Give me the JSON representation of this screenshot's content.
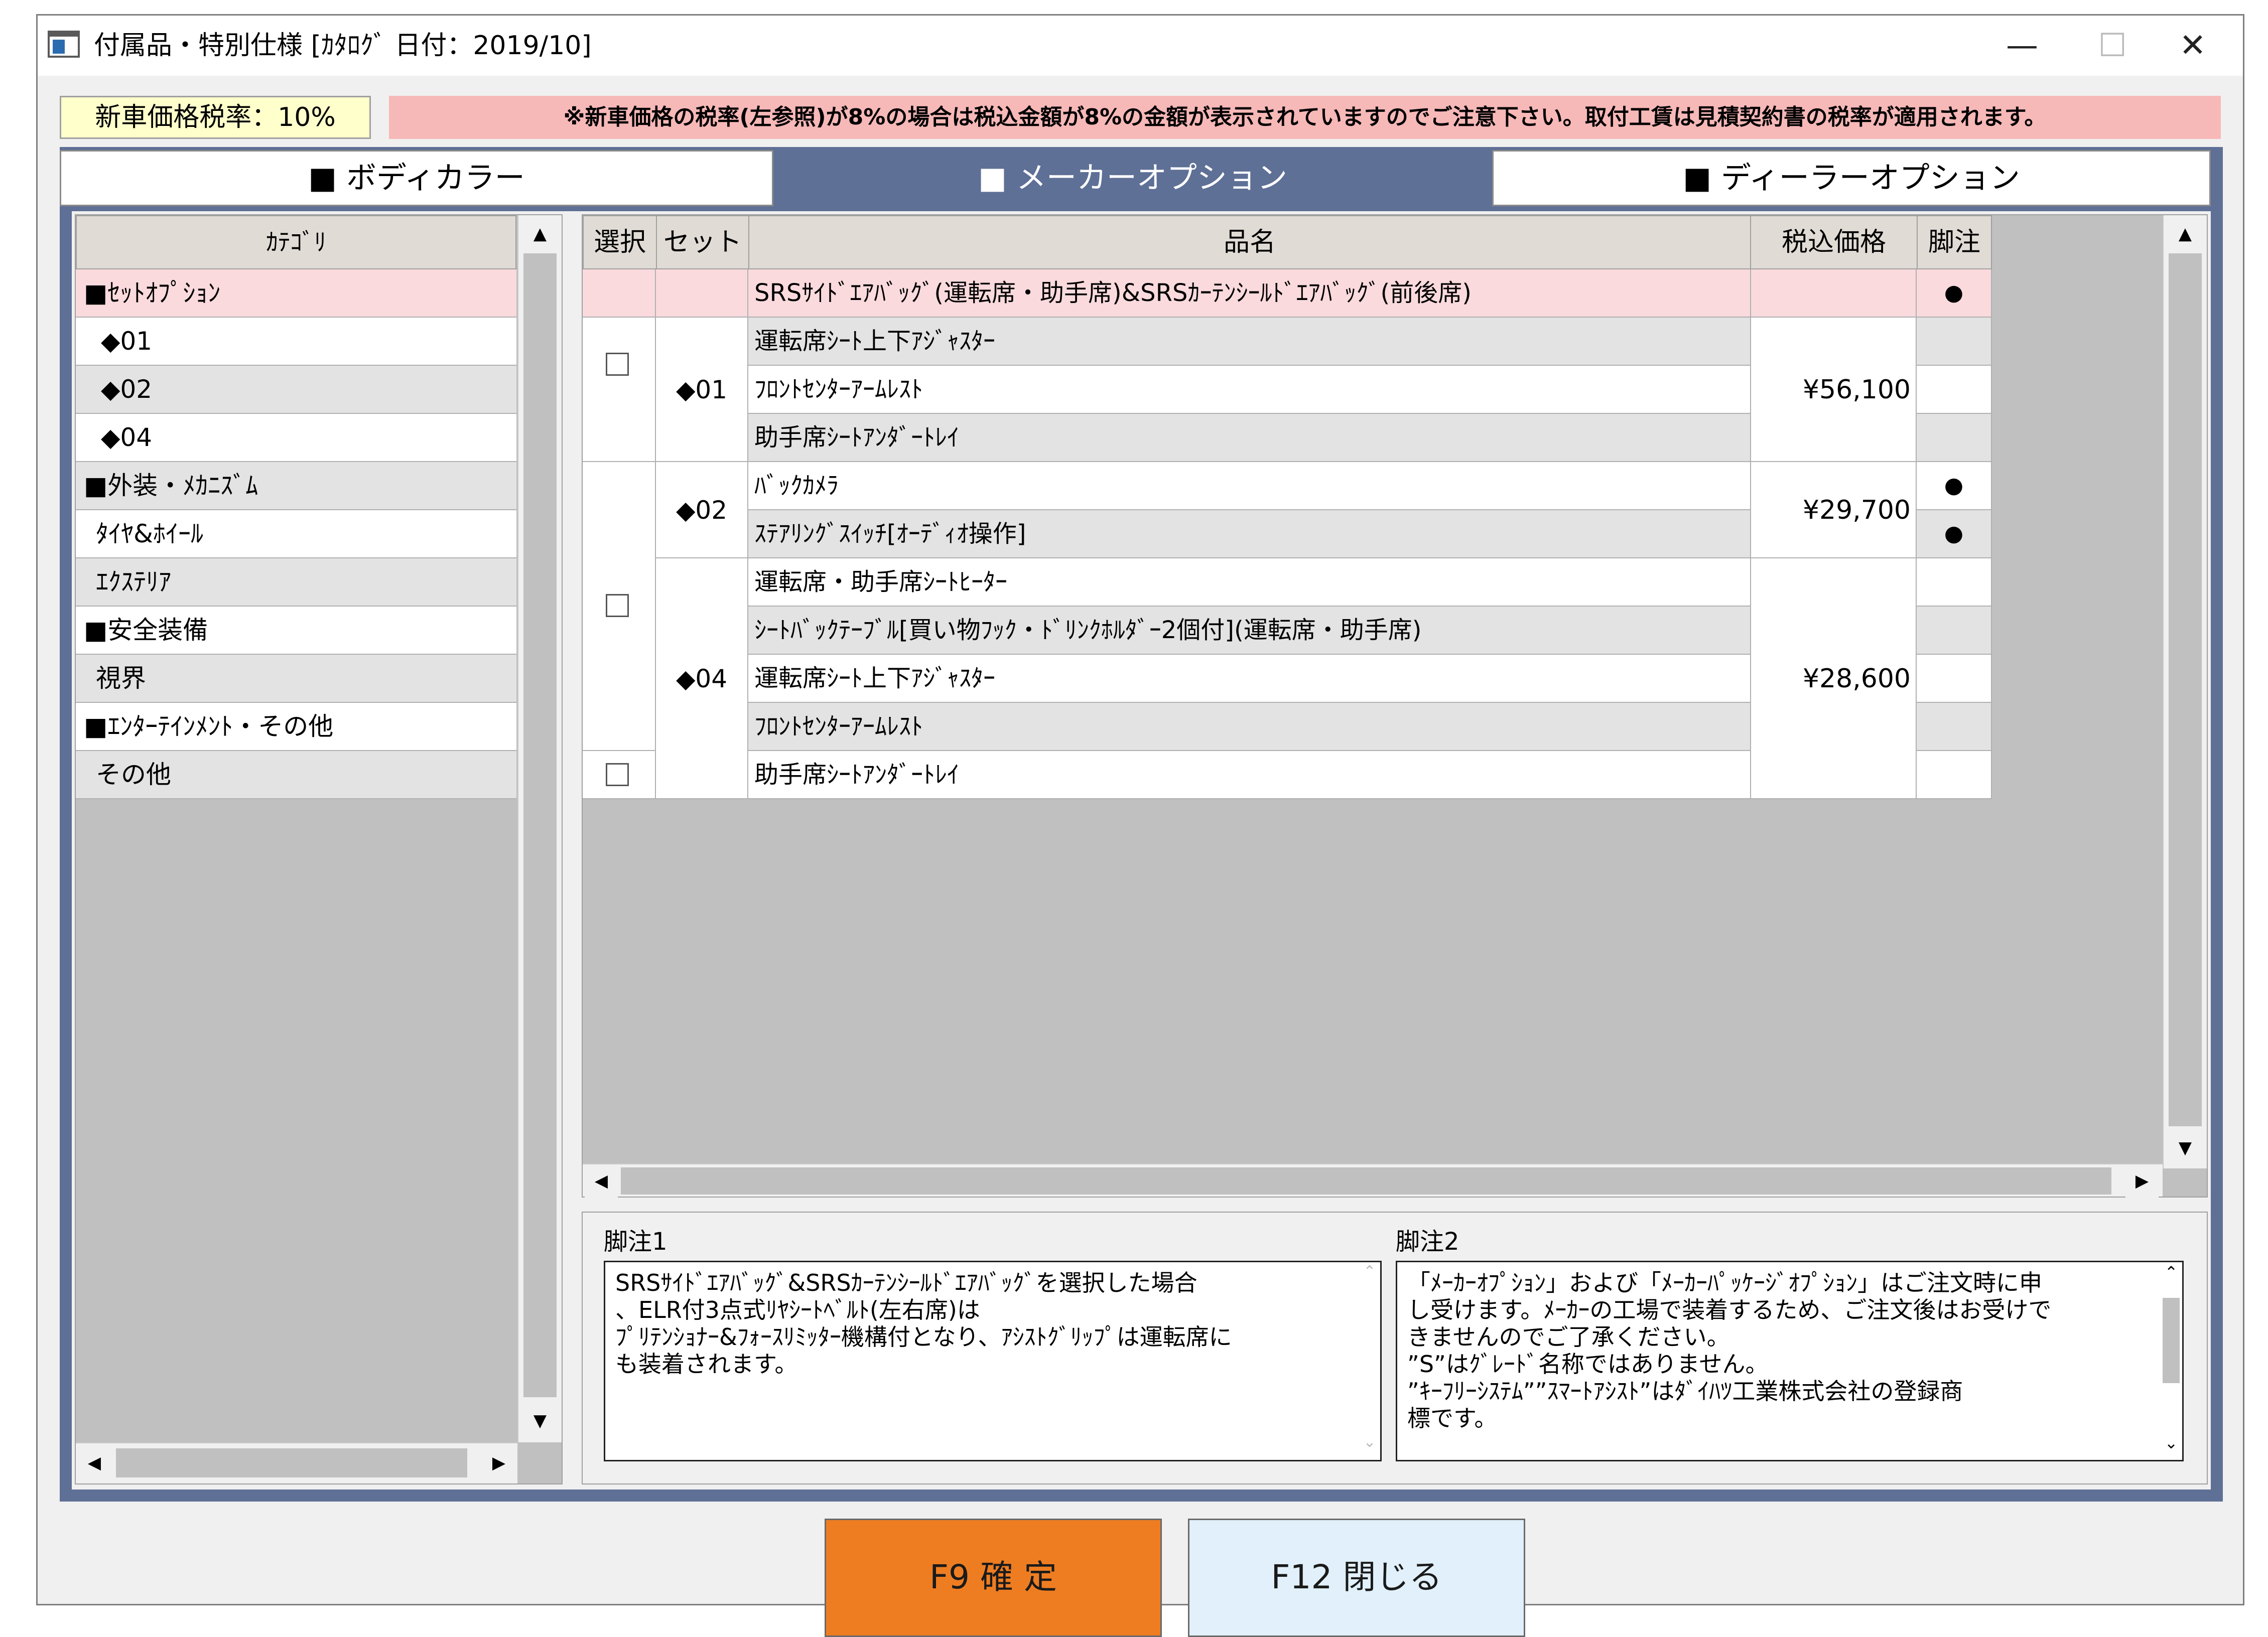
{
  "window": {
    "title": "付属品・特別仕様 [ｶﾀﾛｸﾞ 日付：2019/10]",
    "minimize": "—",
    "maximize": "☐",
    "close": "✕"
  },
  "tax": {
    "rate_label": "新車価格税率：10%",
    "notice": "※新車価格の税率(左参照)が8%の場合は税込金額が8%の金額が表示されていますのでご注意下さい。取付工賃は見積契約書の税率が適用されます。"
  },
  "tabs": [
    {
      "label": "■ ボディカラー",
      "active": false
    },
    {
      "label": "■ メーカーオプション",
      "active": true
    },
    {
      "label": "■ ディーラーオプション",
      "active": false
    }
  ],
  "categories": {
    "header": "ｶﾃｺﾞﾘ",
    "items": [
      {
        "label": "■ｾｯﾄｵﾌﾟｼｮﾝ",
        "selected": true
      },
      {
        "label": "◆01"
      },
      {
        "label": "◆02"
      },
      {
        "label": "◆04"
      },
      {
        "label": "■外装・ﾒｶﾆｽﾞﾑ"
      },
      {
        "label": "ﾀｲﾔ&ﾎｲｰﾙ"
      },
      {
        "label": "ｴｸｽﾃﾘｱ"
      },
      {
        "label": "■安全装備"
      },
      {
        "label": "視界"
      },
      {
        "label": "■ｴﾝﾀｰﾃｲﾝﾒﾝﾄ・その他"
      },
      {
        "label": "その他"
      }
    ]
  },
  "options": {
    "headers": {
      "select": "選択",
      "set": "セット",
      "name": "品名",
      "price": "税込価格",
      "note": "脚注"
    },
    "highlight_row": {
      "name": "SRSｻｲﾄﾞｴｱﾊﾞｯｸﾞ(運転席・助手席)&SRSｶｰﾃﾝｼｰﾙﾄﾞｴｱﾊﾞｯｸﾞ(前後席)",
      "note": "●"
    },
    "groups": [
      {
        "set": "◆01",
        "price": "¥56,100",
        "items": [
          {
            "name": "運転席ｼｰﾄ上下ｱｼﾞｬｽﾀｰ",
            "note": ""
          },
          {
            "name": "ﾌﾛﾝﾄｾﾝﾀｰｱｰﾑﾚｽﾄ",
            "note": ""
          },
          {
            "name": "助手席ｼｰﾄｱﾝﾀﾞｰﾄﾚｲ",
            "note": ""
          }
        ]
      },
      {
        "set": "◆02",
        "price": "¥29,700",
        "items": [
          {
            "name": "ﾊﾞｯｸｶﾒﾗ",
            "note": "●"
          },
          {
            "name": "ｽﾃｱﾘﾝｸﾞｽｲｯﾁ[ｵｰﾃﾞｨｵ操作]",
            "note": "●"
          }
        ]
      },
      {
        "set": "◆04",
        "price": "¥28,600",
        "items": [
          {
            "name": "運転席・助手席ｼｰﾄﾋｰﾀｰ",
            "note": ""
          },
          {
            "name": "ｼｰﾄﾊﾞｯｸﾃｰﾌﾞﾙ[買い物ﾌｯｸ・ﾄﾞﾘﾝｸﾎﾙﾀﾞｰ2個付](運転席・助手席)",
            "note": ""
          },
          {
            "name": "運転席ｼｰﾄ上下ｱｼﾞｬｽﾀｰ",
            "note": ""
          },
          {
            "name": "ﾌﾛﾝﾄｾﾝﾀｰｱｰﾑﾚｽﾄ",
            "note": ""
          },
          {
            "name": "助手席ｼｰﾄｱﾝﾀﾞｰﾄﾚｲ",
            "note": ""
          }
        ]
      }
    ]
  },
  "footnotes": {
    "note1_label": "脚注1",
    "note1_text": "SRSｻｲﾄﾞｴｱﾊﾞｯｸﾞ&SRSｶｰﾃﾝｼｰﾙﾄﾞｴｱﾊﾞｯｸﾞを選択した場合\n、ELR付3点式ﾘﾔｼｰﾄﾍﾞﾙﾄ(左右席)は\nﾌﾟﾘﾃﾝｼｮﾅｰ&ﾌｫｰｽﾘﾐｯﾀｰ機構付となり、ｱｼｽﾄｸﾞﾘｯﾌﾟは運転席に\nも装着されます。",
    "note2_label": "脚注2",
    "note2_text": "「ﾒｰｶｰｵﾌﾟｼｮﾝ」および「ﾒｰｶｰﾊﾟｯｹｰｼﾞｵﾌﾟｼｮﾝ」はご注文時に申\nし受けます。ﾒｰｶｰの工場で装着するため、ご注文後はお受けで\nきませんのでご了承ください。\n”S”はｸﾞﾚｰﾄﾞ名称ではありません。\n”ｷｰﾌﾘｰｼｽﾃﾑ””ｽﾏｰﾄｱｼｽﾄ”はﾀﾞｲﾊﾂ工業株式会社の登録商\n標です。"
  },
  "buttons": {
    "confirm": "F9 確 定",
    "close": "F12 閉じる"
  },
  "colors": {
    "frame": "#5f7096",
    "selected_row": "#fadadd",
    "confirm": "#ee7d22",
    "close": "#e1f0fa",
    "tax_rate_bg": "#ffffcc",
    "notice_bg": "#f7b8b8"
  }
}
